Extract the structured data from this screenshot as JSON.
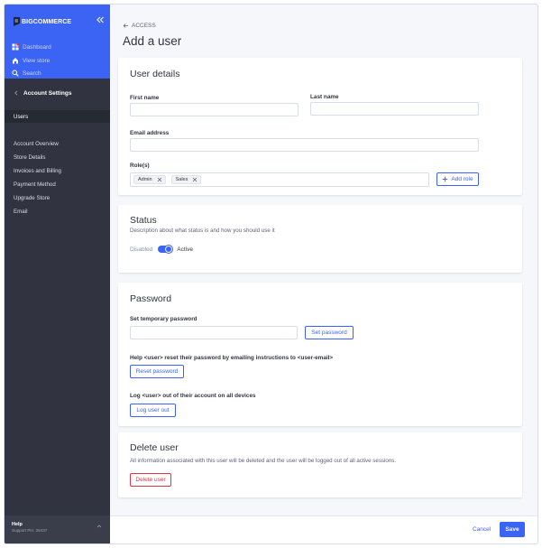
{
  "brand": {
    "logo_text": "BIGCOMMERCE",
    "accent": "#3c64f4",
    "sidebar_bg": "#313440",
    "danger": "#db3643"
  },
  "sidebar": {
    "top_items": [
      {
        "label": "Dashboard",
        "icon": "dashboard-icon"
      },
      {
        "label": "View store",
        "icon": "storefront-icon"
      },
      {
        "label": "Search",
        "icon": "search-icon"
      }
    ],
    "section_title": "Account Settings",
    "items": [
      {
        "label": "Users",
        "active": true
      },
      {
        "label": "Account Overview"
      },
      {
        "label": "Store Details"
      },
      {
        "label": "Invoices and Billing"
      },
      {
        "label": "Payment Method"
      },
      {
        "label": "Upgrade Store"
      },
      {
        "label": "Email"
      }
    ],
    "help": {
      "label": "Help",
      "sub": "Support Pin: 36437"
    }
  },
  "header": {
    "breadcrumb": "ACCESS",
    "title": "Add a user"
  },
  "user_details": {
    "title": "User details",
    "first_name_label": "First name",
    "first_name_value": "",
    "last_name_label": "Last name",
    "last_name_value": "",
    "email_label": "Email address",
    "email_value": "",
    "roles_label": "Role(s)",
    "roles": [
      "Admin",
      "Sales"
    ],
    "add_role_label": "Add role"
  },
  "status": {
    "title": "Status",
    "description": "Description about what status is and how you should use it",
    "off_label": "Disabled",
    "on_label": "Active",
    "enabled": true
  },
  "password": {
    "title": "Password",
    "temp_label": "Set temporary password",
    "temp_value": "",
    "set_button": "Set password",
    "reset_help": "Help <user> reset their password by emailing instructions to <user-email>",
    "reset_button": "Reset password",
    "logout_help": "Log <user> out of their account on all devices",
    "logout_button": "Log user out"
  },
  "delete": {
    "title": "Delete user",
    "description": "All information associated with this user will be deleted and the user will be logged out of all active sessions.",
    "button": "Delete user"
  },
  "footer": {
    "cancel": "Cancel",
    "save": "Save"
  }
}
